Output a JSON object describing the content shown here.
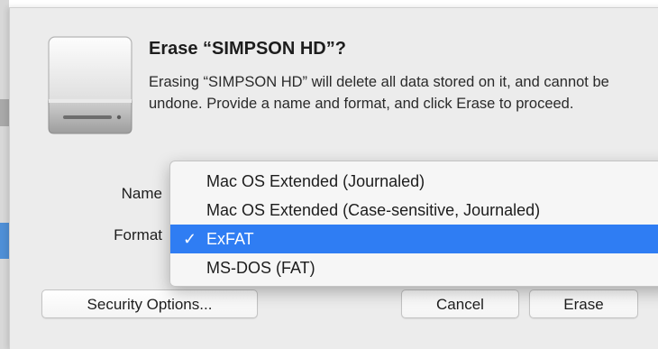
{
  "dialog": {
    "title": "Erase “SIMPSON HD”?",
    "message": "Erasing “SIMPSON HD” will delete all data stored on it, and cannot be undone. Provide a name and format, and click Erase to proceed.",
    "icon": "external-disk-icon"
  },
  "form": {
    "name_label": "Name",
    "format_label": "Format"
  },
  "format_menu": {
    "check_mark": "✓",
    "selected": "ExFAT",
    "options": [
      {
        "label": "Mac OS Extended (Journaled)",
        "checked": false
      },
      {
        "label": "Mac OS Extended (Case-sensitive, Journaled)",
        "checked": false
      },
      {
        "label": "ExFAT",
        "checked": true
      },
      {
        "label": "MS-DOS (FAT)",
        "checked": false
      }
    ]
  },
  "buttons": {
    "security_options": "Security Options...",
    "cancel": "Cancel",
    "erase": "Erase"
  },
  "colors": {
    "menu_highlight": "#2f7df3",
    "sheet_background": "#ececec"
  }
}
